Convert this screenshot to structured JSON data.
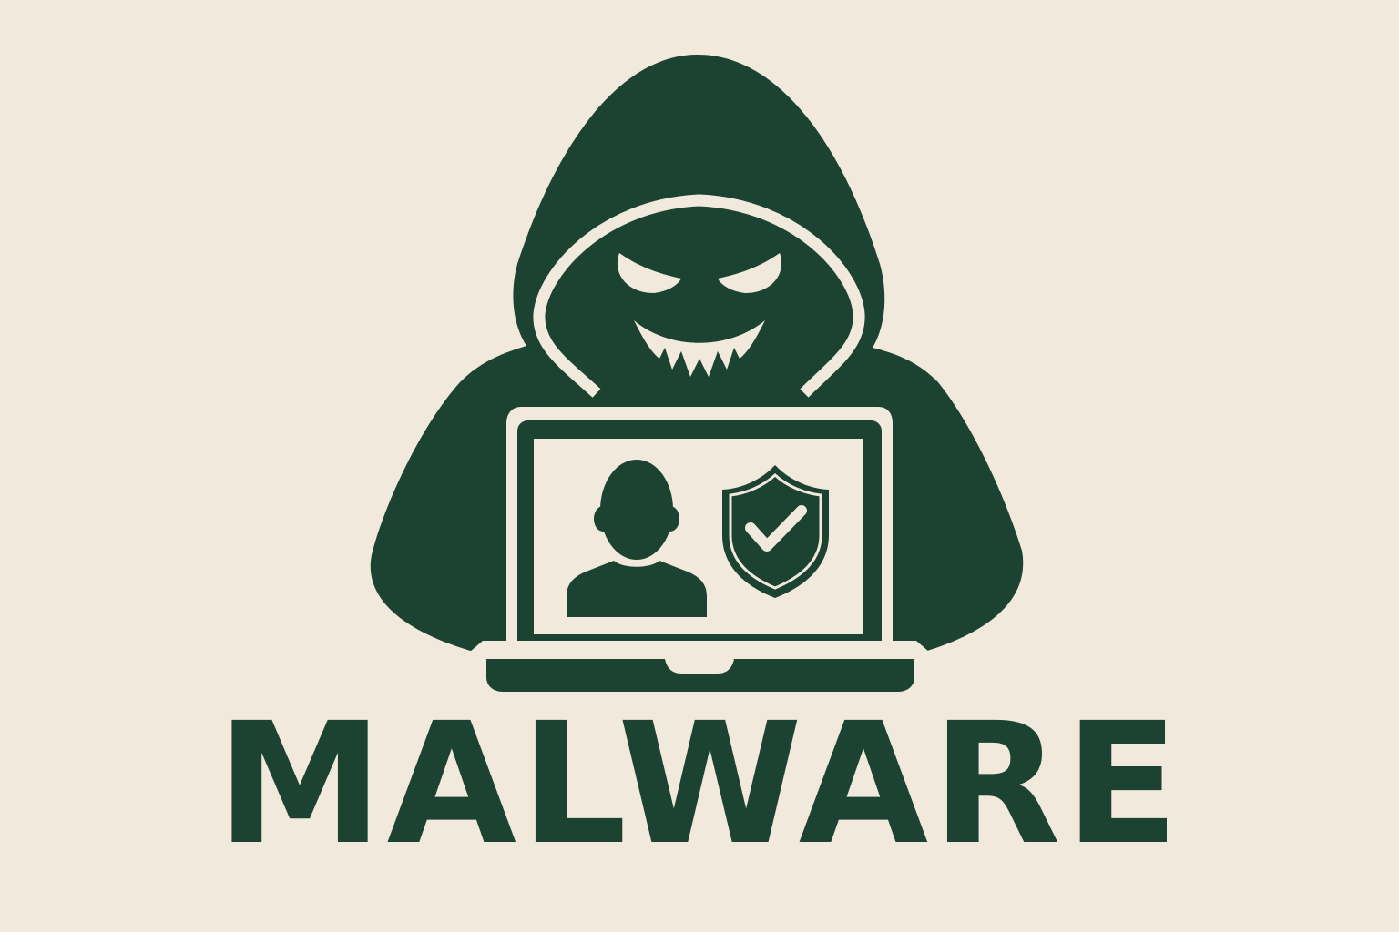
{
  "title": "MALWARE",
  "colors": {
    "background": "#f1e9db",
    "ink": "#1c4232"
  },
  "icons": {
    "figure": "hooded-hacker-icon",
    "face": "evil-grin-face-icon",
    "device": "laptop-icon",
    "user": "user-silhouette-icon",
    "shield": "shield-check-icon"
  }
}
